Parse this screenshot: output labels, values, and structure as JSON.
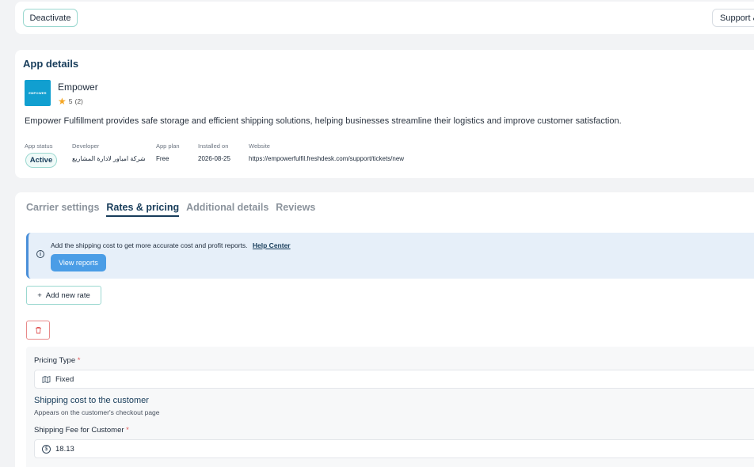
{
  "top_bar": {
    "deactivate_label": "Deactivate",
    "support_label": "Support &"
  },
  "app_details": {
    "title": "App details",
    "logo_text": "EMPOWER",
    "name": "Empower",
    "rating": "5",
    "rating_count": "(2)",
    "description": "Empower Fulfillment provides safe storage and efficient shipping solutions, helping businesses streamline their logistics and improve customer satisfaction.",
    "meta": {
      "status_label": "App status",
      "status_value": "Active",
      "developer_label": "Developer",
      "developer_value": "شركة امباور لادارة المشاريع",
      "plan_label": "App plan",
      "plan_value": "Free",
      "installed_label": "Installed on",
      "installed_value": "2026-08-25",
      "website_label": "Website",
      "website_value": "https://empowerfulfil.freshdesk.com/support/tickets/new"
    }
  },
  "tabs": [
    {
      "label": "Carrier settings",
      "active": false
    },
    {
      "label": "Rates & pricing",
      "active": true
    },
    {
      "label": "Additional details",
      "active": false
    },
    {
      "label": "Reviews",
      "active": false
    }
  ],
  "banner": {
    "text": "Add the shipping cost to get more accurate cost and profit reports.",
    "link": "Help Center",
    "button": "View reports"
  },
  "add_rate_label": "Add new rate",
  "rate": {
    "pricing_type_label": "Pricing Type",
    "pricing_type_value": "Fixed",
    "shipping_heading": "Shipping cost to the customer",
    "shipping_sub": "Appears on the customer's checkout page",
    "fee_label": "Shipping Fee for Customer",
    "fee_value": "18.13",
    "required_mark": "*"
  },
  "colors": {
    "accent": "#173c5a",
    "teal_border": "#9bd8d0",
    "banner_bg": "#e6eff9",
    "button_blue": "#4a9de6",
    "danger": "#e25d5d"
  }
}
